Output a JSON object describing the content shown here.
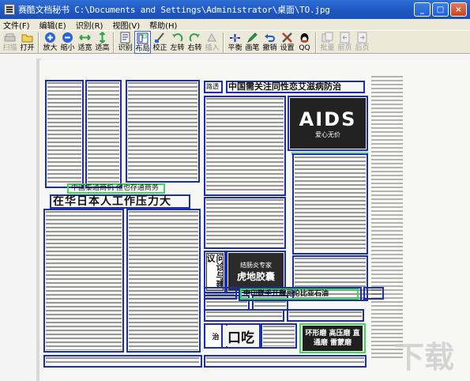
{
  "window": {
    "title": "赛酷文档秘书 C:\\Documents and Settings\\Administrator\\桌面\\TO.jpg",
    "controls": {
      "minimize": "_",
      "maximize": "□",
      "close": "×"
    }
  },
  "menu": [
    {
      "label": "文件(F)"
    },
    {
      "label": "编辑(E)"
    },
    {
      "label": "识别(R)"
    },
    {
      "label": "视图(V)"
    },
    {
      "label": "帮助(H)"
    }
  ],
  "toolbar": {
    "items": [
      {
        "label": "扫描",
        "icon": "scanner-icon",
        "enabled": false
      },
      {
        "label": "打开",
        "icon": "folder-open-icon",
        "enabled": true
      },
      {
        "label": "放大",
        "icon": "zoom-in-icon",
        "enabled": true
      },
      {
        "label": "缩小",
        "icon": "zoom-out-icon",
        "enabled": true
      },
      {
        "label": "适宽",
        "icon": "fit-width-icon",
        "enabled": true
      },
      {
        "label": "适高",
        "icon": "fit-height-icon",
        "enabled": true
      },
      {
        "label": "识别",
        "icon": "recognize-icon",
        "enabled": true
      },
      {
        "label": "布局",
        "icon": "layout-icon",
        "enabled": true,
        "active": true
      },
      {
        "label": "校正",
        "icon": "deskew-icon",
        "enabled": true
      },
      {
        "label": "左转",
        "icon": "rotate-left-icon",
        "enabled": true
      },
      {
        "label": "右转",
        "icon": "rotate-right-icon",
        "enabled": true
      },
      {
        "label": "插入",
        "icon": "insert-icon",
        "enabled": false
      },
      {
        "label": "平衡",
        "icon": "balance-icon",
        "enabled": true
      },
      {
        "label": "画笔",
        "icon": "pen-icon",
        "enabled": true
      },
      {
        "label": "撤销",
        "icon": "undo-icon",
        "enabled": true
      },
      {
        "label": "设置",
        "icon": "tools-icon",
        "enabled": true
      },
      {
        "label": "QQ",
        "icon": "qq-penguin-icon",
        "enabled": true
      },
      {
        "label": "批量",
        "icon": "batch-icon",
        "enabled": false
      },
      {
        "label": "前页",
        "icon": "prev-page-icon",
        "enabled": false
      },
      {
        "label": "后页",
        "icon": "next-page-icon",
        "enabled": false
      }
    ]
  },
  "document": {
    "headlines": {
      "main_right": "中国需关注同性恋艾滋病防治",
      "left_sub": "中国泰通商机 但也存通商务",
      "left_main": "在华日本人工作压力大",
      "small_label": "路透",
      "bottom_mid": "中印联手开展哥伦比亚石油"
    },
    "ads": {
      "aids_banner": "AIDS",
      "aids_sub": "爱心无价",
      "clinic_side": "问诊与建议",
      "clinic_main": "虎地胶囊",
      "clinic_top": "结肠炎专家",
      "bottom_logo": "口吃",
      "bottom_ad": "环形磨 高压磨 直通磨 雷蒙磨"
    },
    "watermark": "下载"
  },
  "colors": {
    "titlebar": "#1e56c2",
    "region_blue": "#1a2fa8",
    "region_green": "#3ddc50",
    "chrome": "#ece9d8"
  }
}
